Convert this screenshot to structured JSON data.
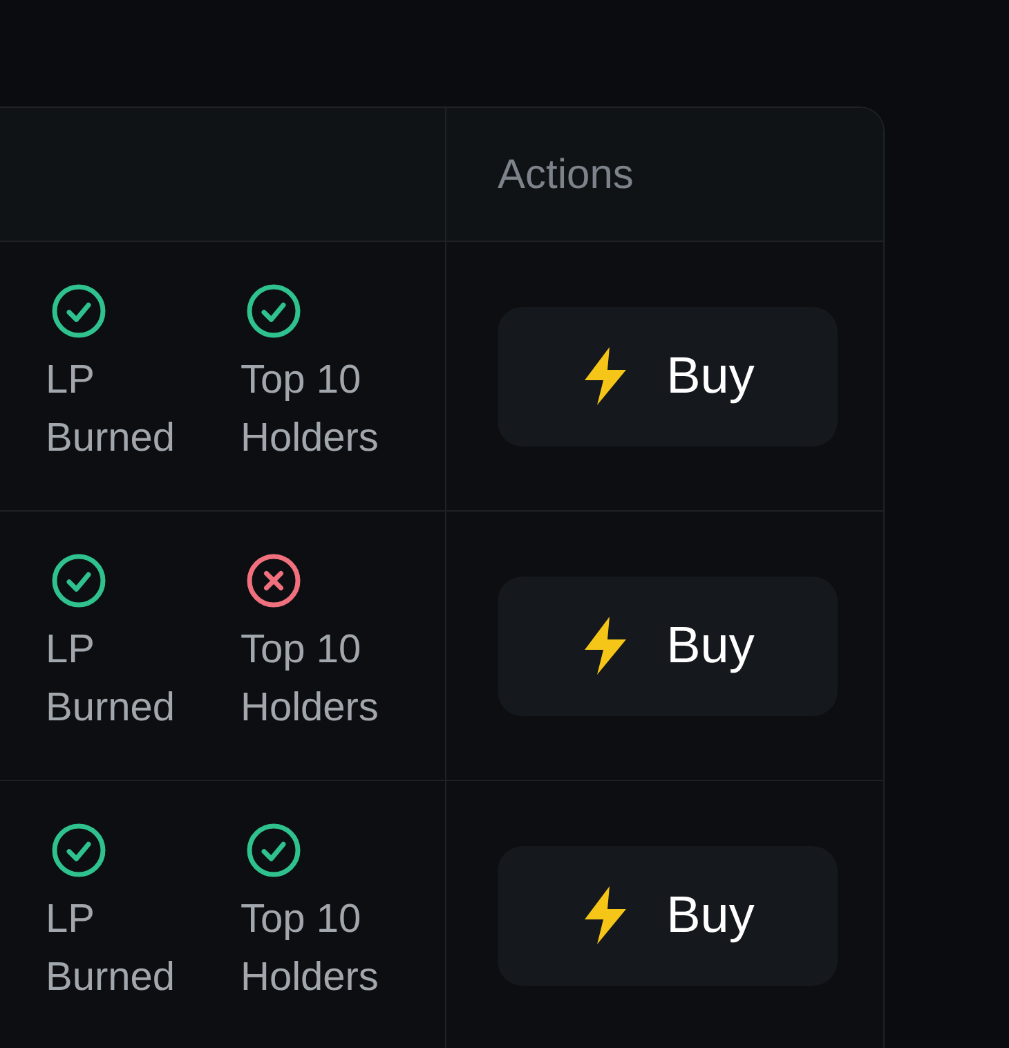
{
  "table": {
    "columns": [
      {
        "label": "Actions"
      }
    ],
    "rows": [
      {
        "checks": [
          {
            "label": "LP Burned",
            "passed": true
          },
          {
            "label": "Top 10 Holders",
            "passed": true
          }
        ],
        "action": "Buy"
      },
      {
        "checks": [
          {
            "label": "LP Burned",
            "passed": true
          },
          {
            "label": "Top 10 Holders",
            "passed": false
          }
        ],
        "action": "Buy"
      },
      {
        "checks": [
          {
            "label": "LP Burned",
            "passed": true
          },
          {
            "label": "Top 10 Holders",
            "passed": true
          }
        ],
        "action": "Buy"
      }
    ]
  }
}
